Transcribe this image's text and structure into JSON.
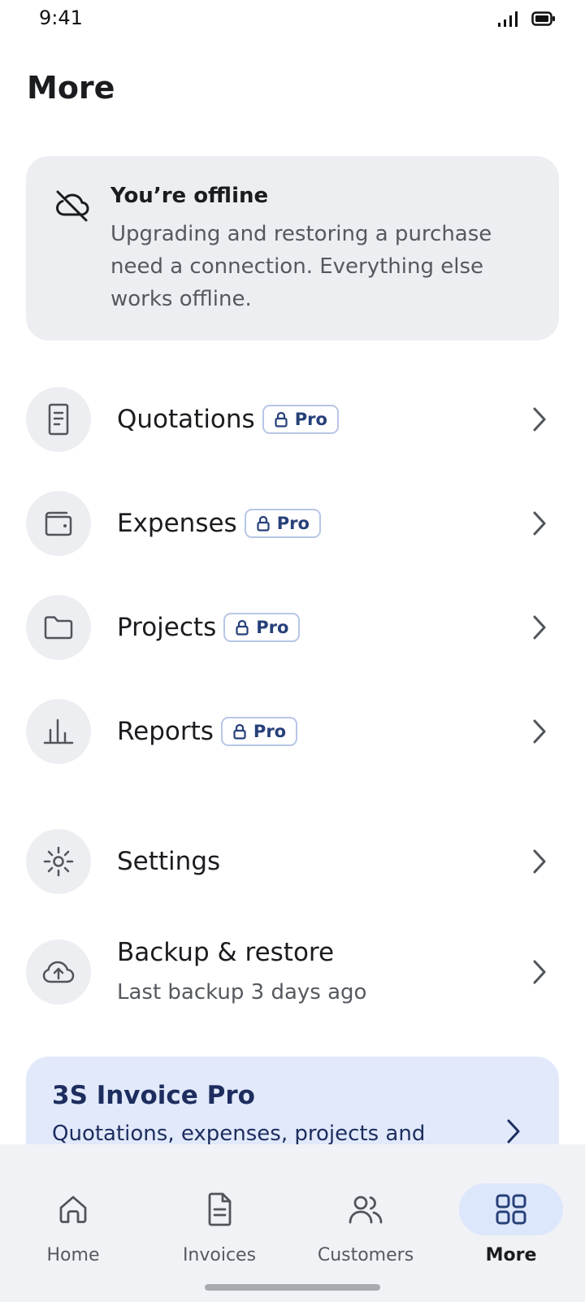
{
  "status_bar": {
    "time": "9:41"
  },
  "header": {
    "title": "More"
  },
  "offline_banner": {
    "title": "You’re offline",
    "body": "Upgrading and restoring a purchase need a connection. Everything else works offline."
  },
  "menu": {
    "pro_badge_label": "Pro",
    "items": [
      {
        "label": "Quotations",
        "icon": "document-icon",
        "locked": true
      },
      {
        "label": "Expenses",
        "icon": "wallet-icon",
        "locked": true
      },
      {
        "label": "Projects",
        "icon": "folder-icon",
        "locked": true
      },
      {
        "label": "Reports",
        "icon": "bar-chart-icon",
        "locked": true
      },
      {
        "label": "Settings",
        "icon": "gear-icon",
        "locked": false
      },
      {
        "label": "Backup & restore",
        "subtitle": "Last backup 3 days ago",
        "icon": "cloud-upload-icon",
        "locked": false
      }
    ]
  },
  "pro_promo": {
    "title": "3S Invoice Pro",
    "subtitle": "Quotations, expenses, projects and"
  },
  "bottom_nav": {
    "items": [
      {
        "label": "Home",
        "icon": "home-icon",
        "active": false
      },
      {
        "label": "Invoices",
        "icon": "invoice-icon",
        "active": false
      },
      {
        "label": "Customers",
        "icon": "customers-icon",
        "active": false
      },
      {
        "label": "More",
        "icon": "grid-icon",
        "active": true
      }
    ]
  },
  "colors": {
    "accent": "#27407a",
    "card_bg": "#eceef1",
    "promo_bg": "#e1e9fb",
    "active_pill": "#dde7fb"
  }
}
